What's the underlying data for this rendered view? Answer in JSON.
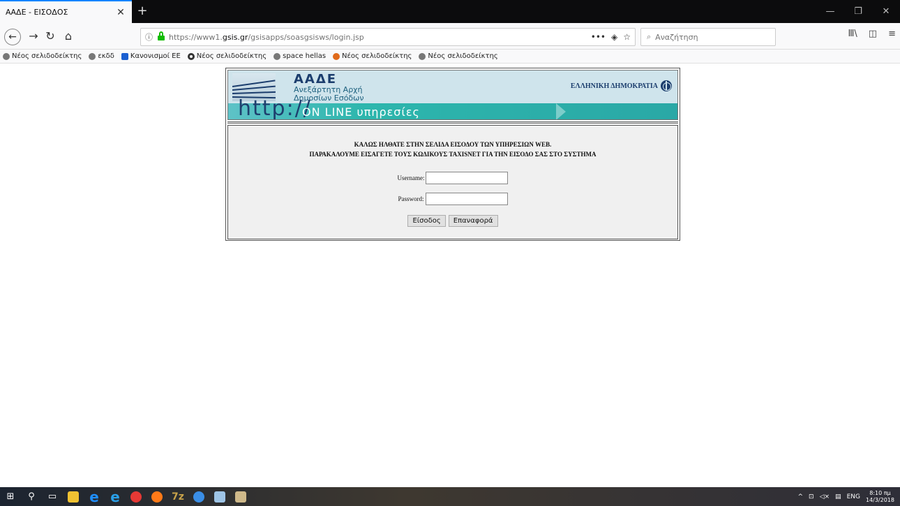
{
  "browser": {
    "tab_title": "ΑΑΔΕ - ΕΙΣΟΔΟΣ",
    "url_prefix": "https://www1.",
    "url_domain": "gsis.gr",
    "url_path": "/gsisapps/soasgsisws/login.jsp",
    "search_placeholder": "Αναζήτηση"
  },
  "bookmarks": [
    {
      "label": "Νέος σελιδοδείκτης",
      "icon": "globe-icon",
      "color": "#777777"
    },
    {
      "label": "εκδδ",
      "icon": "globe-icon",
      "color": "#777777"
    },
    {
      "label": "Κανονισμοί ΕΕ",
      "icon": "monitor-icon",
      "color": "#1a5fd1"
    },
    {
      "label": "Νέος σελιδοδείκτης",
      "icon": "circle-icon",
      "color": "#333333"
    },
    {
      "label": "space hellas",
      "icon": "globe-icon",
      "color": "#777777"
    },
    {
      "label": "Νέος σελιδοδείκτης",
      "icon": "leaf-icon",
      "color": "#e06a1a"
    },
    {
      "label": "Νέος σελιδοδείκτης",
      "icon": "globe-icon",
      "color": "#777777"
    }
  ],
  "banner": {
    "org_name": "ΑΑΔΕ",
    "org_sub_1": "Ανεξάρτητη Αρχή",
    "org_sub_2": "Δημοσίων Εσόδων",
    "republic": "ΕΛΛΗΝΙΚΗ ΔΗΜΟΚΡΑΤΙΑ",
    "http": "http://",
    "online": "ON LINE υπηρεσίες"
  },
  "login": {
    "welcome_1": "ΚΑΛΩΣ ΗΛΘΑΤΕ ΣΤΗΝ ΣΕΛΙΔΑ ΕΙΣΟΔΟΥ ΤΩΝ ΥΠΗΡΕΣΙΩΝ WEB.",
    "welcome_2": "ΠΑΡΑΚΑΛΟΥΜΕ ΕΙΣΑΓΕΤΕ ΤΟΥΣ ΚΩΔΙΚΟΥΣ TAXISNET ΓΙΑ ΤΗΝ ΕΙΣΟΔΟ ΣΑΣ ΣΤΟ ΣΥΣΤΗΜΑ",
    "username_label": "Username:",
    "username_value": "",
    "password_label": "Password:",
    "password_value": "",
    "submit_label": "Είσοδος",
    "reset_label": "Επαναφορά"
  },
  "taskbar": {
    "lang": "ENG",
    "time": "8:10 πμ",
    "date": "14/3/2018"
  }
}
